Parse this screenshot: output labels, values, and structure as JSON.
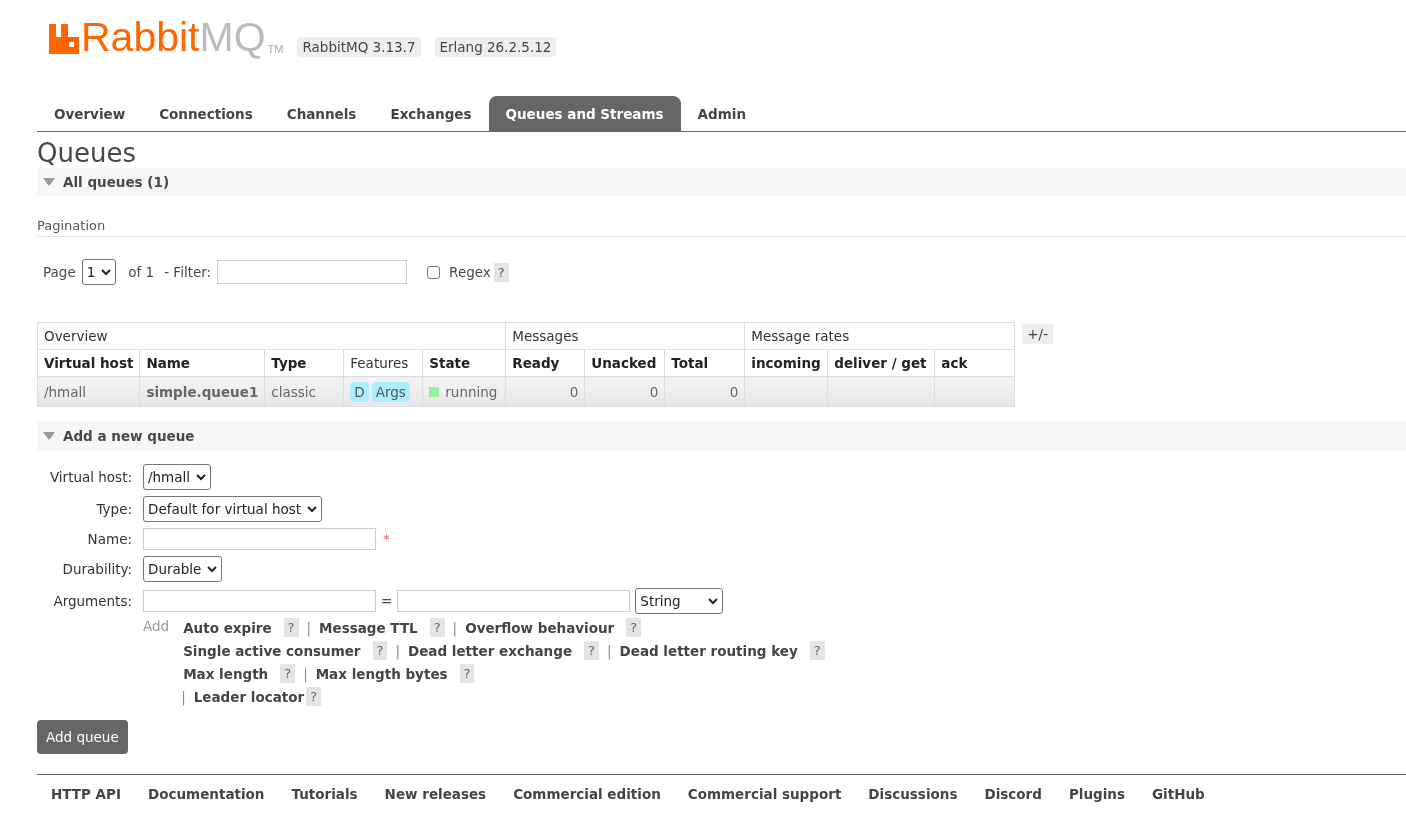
{
  "header": {
    "logo": {
      "brand": "Rabbit",
      "brand_suffix": "MQ",
      "tm": "TM"
    },
    "versions": [
      "RabbitMQ 3.13.7",
      "Erlang 26.2.5.12"
    ]
  },
  "tabs": [
    {
      "label": "Overview",
      "selected": false
    },
    {
      "label": "Connections",
      "selected": false
    },
    {
      "label": "Channels",
      "selected": false
    },
    {
      "label": "Exchanges",
      "selected": false
    },
    {
      "label": "Queues and Streams",
      "selected": true
    },
    {
      "label": "Admin",
      "selected": false
    }
  ],
  "page_title": "Queues",
  "all_queues": {
    "title": "All queues (1)",
    "expanded": true,
    "pagination": {
      "title": "Pagination",
      "page_label": "Page",
      "page": "1",
      "of": "of 1",
      "filter_label": "- Filter:",
      "regex_label": "Regex",
      "regex_checked": false,
      "help": "?"
    },
    "table": {
      "groups": [
        {
          "label": "Overview",
          "columns": [
            {
              "label": "Virtual host",
              "bold": true
            },
            {
              "label": "Name",
              "bold": true
            },
            {
              "label": "Type",
              "bold": true
            },
            {
              "label": "Features",
              "bold": false
            },
            {
              "label": "State",
              "bold": true
            }
          ]
        },
        {
          "label": "Messages",
          "columns": [
            {
              "label": "Ready",
              "bold": true
            },
            {
              "label": "Unacked",
              "bold": true
            },
            {
              "label": "Total",
              "bold": true
            }
          ]
        },
        {
          "label": "Message rates",
          "columns": [
            {
              "label": "incoming",
              "bold": true
            },
            {
              "label": "deliver / get",
              "bold": true
            },
            {
              "label": "ack",
              "bold": true
            }
          ]
        }
      ],
      "rows": [
        {
          "virtual_host": "/hmall",
          "name": "simple.queue1",
          "type": "classic",
          "features": [
            "D",
            "Args"
          ],
          "state": {
            "label": "running",
            "color": "#99ee99"
          },
          "ready": "0",
          "unacked": "0",
          "total": "0"
        }
      ],
      "toggle": "+/-"
    }
  },
  "add_queue": {
    "title": "Add a new queue",
    "expanded": true,
    "fields": [
      {
        "kind": "select",
        "label": "Virtual host:",
        "value": "/hmall"
      },
      {
        "kind": "select",
        "label": "Type:",
        "value": "Default for virtual host"
      },
      {
        "kind": "text",
        "label": "Name:",
        "required": true
      },
      {
        "kind": "select",
        "label": "Durability:",
        "value": "Durable"
      },
      {
        "kind": "arguments",
        "label": "Arguments:",
        "equals": "=",
        "type_value": "String"
      }
    ],
    "add_label": "Add",
    "shortcut_lines": [
      {
        "lead_bar": false,
        "items": [
          {
            "label": "Auto expire",
            "help": "?"
          },
          {
            "label": "Message TTL",
            "help": "?"
          },
          {
            "label": "Overflow behaviour",
            "help": "?"
          }
        ]
      },
      {
        "lead_bar": false,
        "items": [
          {
            "label": "Single active consumer",
            "help": "?"
          },
          {
            "label": "Dead letter exchange",
            "help": "?"
          },
          {
            "label": "Dead letter routing key",
            "help": "?"
          }
        ]
      },
      {
        "lead_bar": false,
        "items": [
          {
            "label": "Max length",
            "help": "?"
          },
          {
            "label": "Max length bytes",
            "help": "?"
          }
        ]
      },
      {
        "lead_bar": true,
        "items": [
          {
            "label": "Leader locator",
            "help": "?"
          }
        ]
      }
    ],
    "separator": "|",
    "required_mark": "*",
    "submit": "Add queue"
  },
  "footer_links": [
    "HTTP API",
    "Documentation",
    "Tutorials",
    "New releases",
    "Commercial edition",
    "Commercial support",
    "Discussions",
    "Discord",
    "Plugins",
    "GitHub"
  ]
}
